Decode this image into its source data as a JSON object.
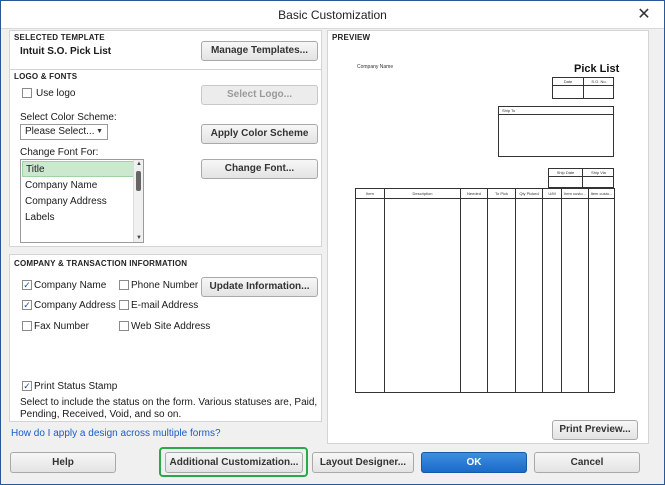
{
  "window": {
    "title": "Basic Customization",
    "close_glyph": "✕"
  },
  "selected_template": {
    "section_label": "SELECTED TEMPLATE",
    "name": "Intuit S.O. Pick List",
    "manage_button": "Manage Templates..."
  },
  "logo_fonts": {
    "section_label": "LOGO & FONTS",
    "use_logo_label": "Use logo",
    "use_logo_checked": false,
    "select_logo_button": "Select Logo...",
    "color_scheme_label": "Select Color Scheme:",
    "color_scheme_value": "Please Select...",
    "apply_color_button": "Apply Color Scheme",
    "change_font_for_label": "Change Font For:",
    "font_items": [
      "Title",
      "Company Name",
      "Company Address",
      "Labels"
    ],
    "selected_font_index": 0,
    "change_font_button": "Change Font..."
  },
  "company": {
    "section_label": "COMPANY & TRANSACTION INFORMATION",
    "checkboxes": [
      {
        "label": "Company Name",
        "checked": true
      },
      {
        "label": "Company Address",
        "checked": true
      },
      {
        "label": "Fax Number",
        "checked": false
      },
      {
        "label": "Phone Number",
        "checked": false
      },
      {
        "label": "E-mail Address",
        "checked": false
      },
      {
        "label": "Web Site Address",
        "checked": false
      }
    ],
    "update_button": "Update Information...",
    "print_status_label": "Print Status Stamp",
    "print_status_checked": true,
    "print_status_description": "Select to include the status on the form. Various statuses are, Paid, Pending, Received, Void, and so on.",
    "check_glyph": "✓"
  },
  "help_link": "How do I apply a design across multiple forms?",
  "preview": {
    "section_label": "PREVIEW",
    "company_name": "Company Name",
    "doc_title": "Pick List",
    "header_cols": [
      "Date",
      "S.O. No."
    ],
    "ship_to_label": "Ship To",
    "ship_cols": [
      "Ship Date",
      "Ship Via"
    ],
    "item_cols": [
      "Item",
      "Description",
      "Needed",
      "To Pick",
      "Qty Picked",
      "U/M",
      "Item custo...",
      "Item custo..."
    ],
    "print_preview_button": "Print Preview..."
  },
  "footer": {
    "help_button": "Help",
    "additional_button": "Additional Customization...",
    "layout_button": "Layout Designer...",
    "ok_button": "OK",
    "cancel_button": "Cancel"
  },
  "colors": {
    "accent": "#1a6ac9",
    "highlight": "#2aa84a",
    "link": "#1a5cc8"
  }
}
